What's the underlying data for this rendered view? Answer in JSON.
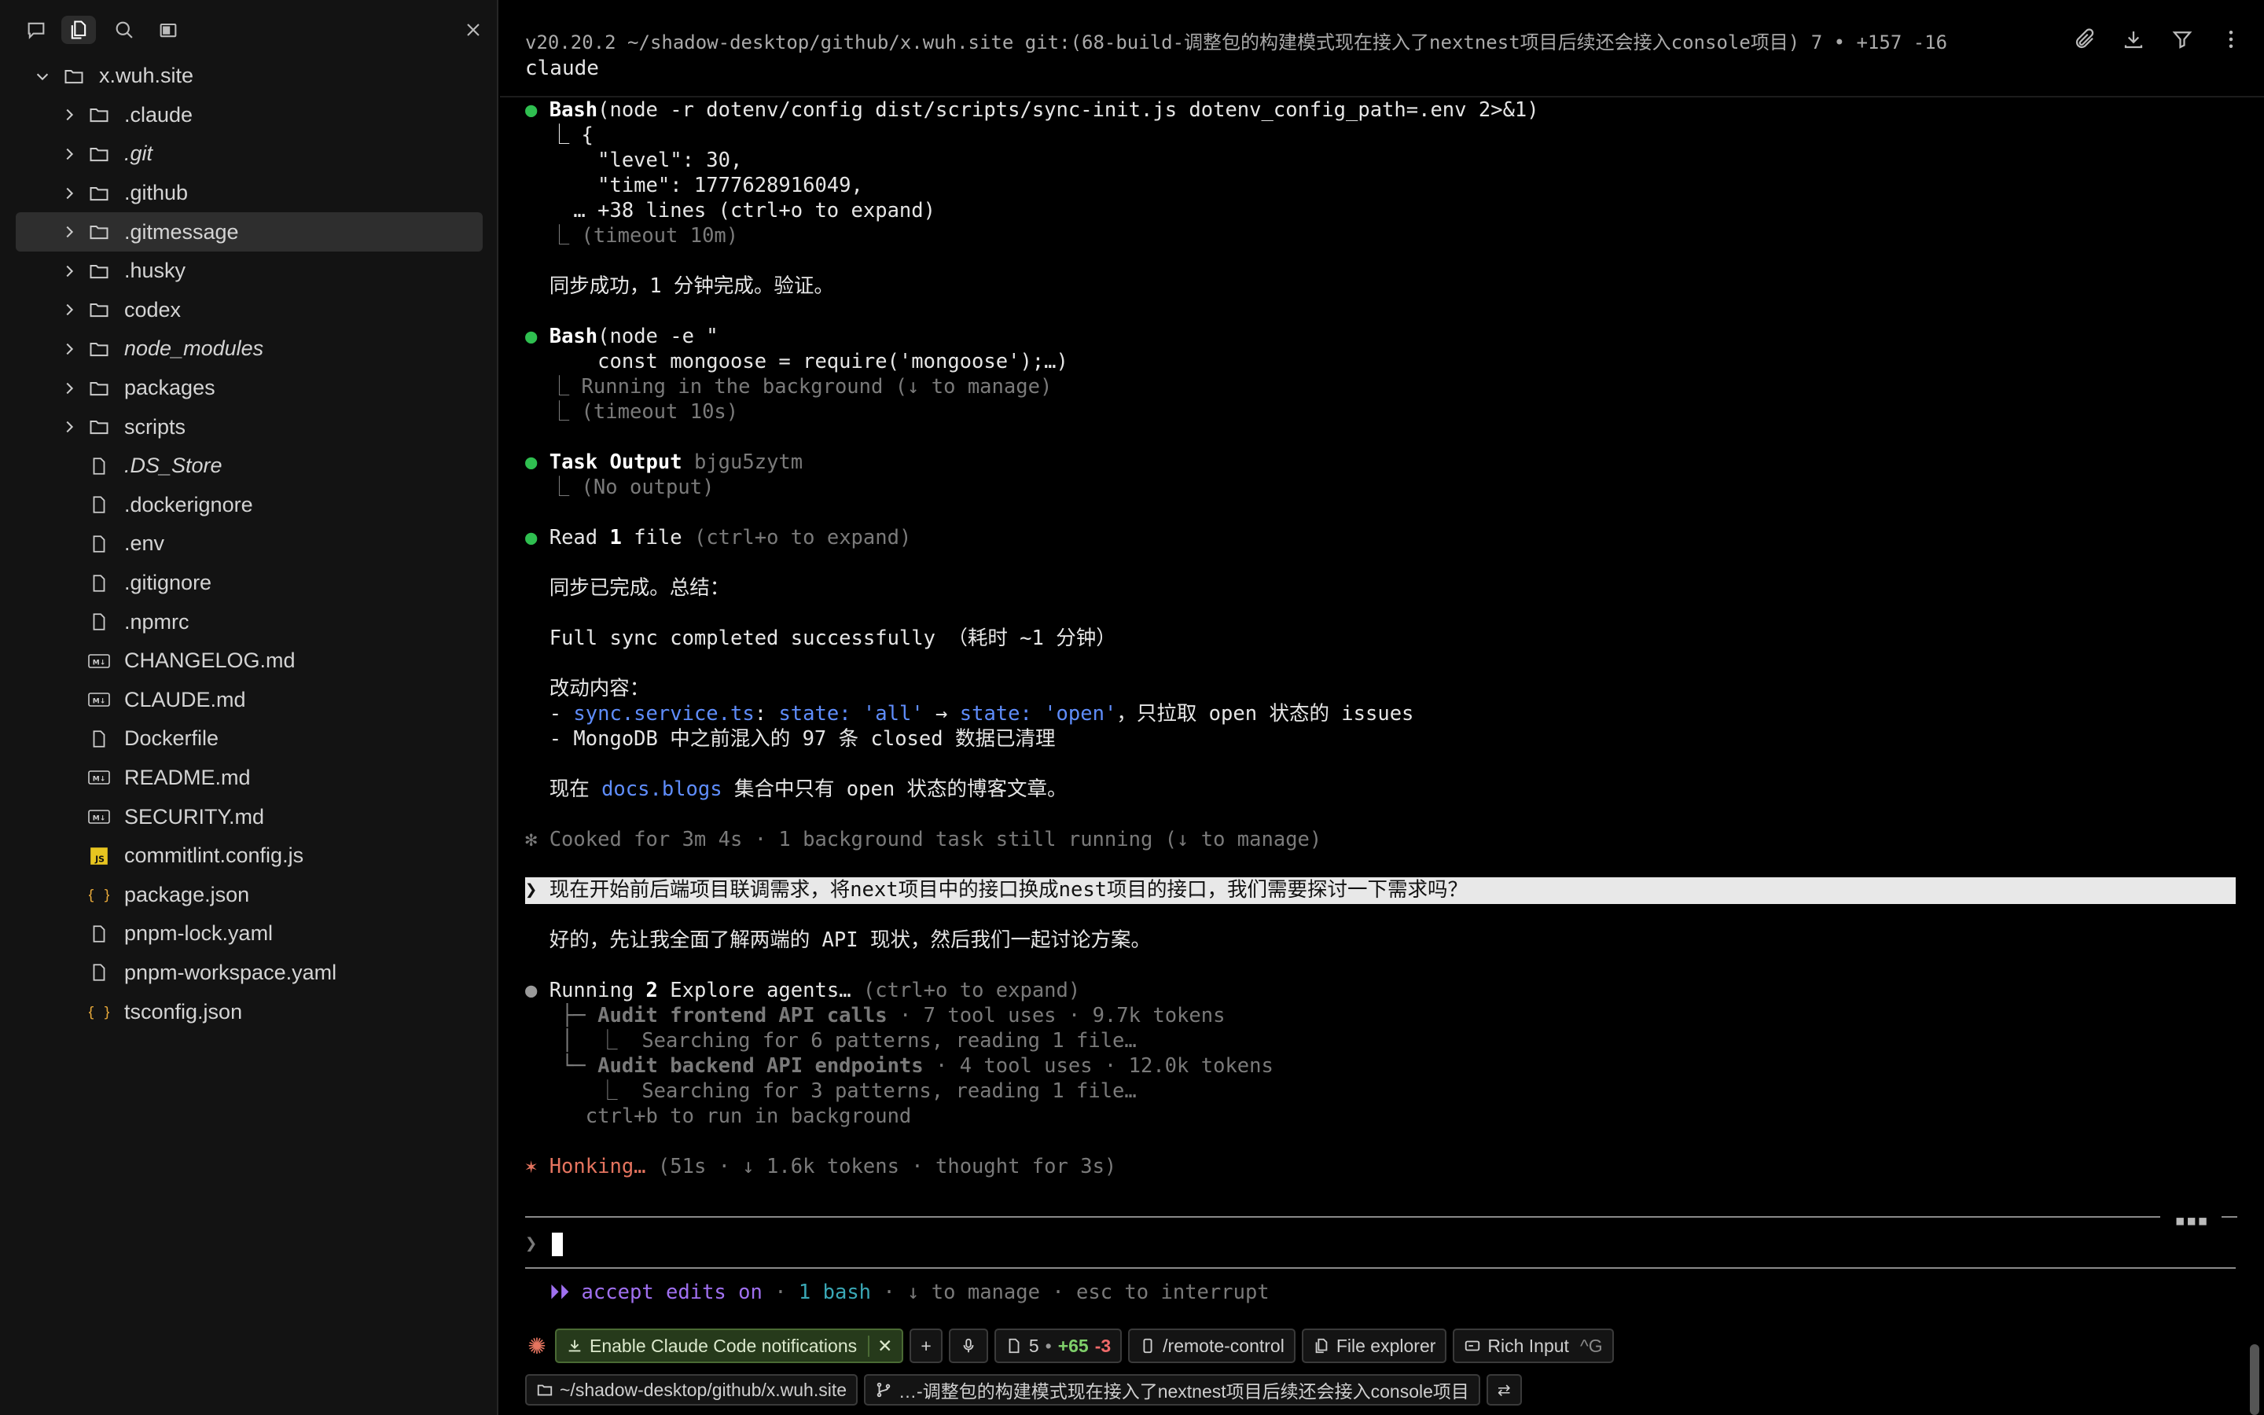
{
  "sidebar": {
    "root": "x.wuh.site",
    "items": [
      {
        "name": ".claude",
        "type": "folder",
        "italic": false
      },
      {
        "name": ".git",
        "type": "folder",
        "italic": true
      },
      {
        "name": ".github",
        "type": "folder",
        "italic": false
      },
      {
        "name": ".gitmessage",
        "type": "folder",
        "italic": false,
        "selected": true
      },
      {
        "name": ".husky",
        "type": "folder",
        "italic": false
      },
      {
        "name": "codex",
        "type": "folder",
        "italic": false
      },
      {
        "name": "node_modules",
        "type": "folder",
        "italic": true
      },
      {
        "name": "packages",
        "type": "folder",
        "italic": false
      },
      {
        "name": "scripts",
        "type": "folder",
        "italic": false
      },
      {
        "name": ".DS_Store",
        "type": "file",
        "italic": true
      },
      {
        "name": ".dockerignore",
        "type": "file",
        "italic": false
      },
      {
        "name": ".env",
        "type": "file",
        "italic": false
      },
      {
        "name": ".gitignore",
        "type": "file",
        "italic": false
      },
      {
        "name": ".npmrc",
        "type": "file",
        "italic": false
      },
      {
        "name": "CHANGELOG.md",
        "type": "md",
        "italic": false
      },
      {
        "name": "CLAUDE.md",
        "type": "md",
        "italic": false
      },
      {
        "name": "Dockerfile",
        "type": "file",
        "italic": false
      },
      {
        "name": "README.md",
        "type": "md",
        "italic": false
      },
      {
        "name": "SECURITY.md",
        "type": "md",
        "italic": false
      },
      {
        "name": "commitlint.config.js",
        "type": "js",
        "italic": false
      },
      {
        "name": "package.json",
        "type": "json",
        "italic": false
      },
      {
        "name": "pnpm-lock.yaml",
        "type": "file",
        "italic": false
      },
      {
        "name": "pnpm-workspace.yaml",
        "type": "file",
        "italic": false
      },
      {
        "name": "tsconfig.json",
        "type": "json",
        "italic": false
      }
    ]
  },
  "terminal": {
    "header_path": "v20.20.2 ~/shadow-desktop/github/x.wuh.site git:(68-build-调整包的构建模式现在接入了nextnest项目后续还会接入console项目) 7 • +157 -16",
    "header_sub": "claude",
    "lines": {
      "l1_tool": "Bash",
      "l1_args": "(node -r dotenv/config dist/scripts/sync-init.js dotenv_config_path=.env 2>&1)",
      "l2": "  ⎿ {",
      "l3": "      \"level\": 30,",
      "l4": "      \"time\": 1777628916049,",
      "l5": "    … +38 lines (ctrl+o to expand)",
      "l6": "  ⎿ (timeout 10m)",
      "l7": "  同步成功，1 分钟完成。验证。",
      "l8_tool": "Bash",
      "l8_args": "(node -e \"",
      "l9": "      const mongoose = require('mongoose');…)",
      "l10": "  ⎿ Running in the background (↓ to manage)",
      "l11": "  ⎿ (timeout 10s)",
      "l12_tool": "Task Output",
      "l12_id": " bjgu5zytm",
      "l13": "  ⎿ (No output)",
      "l14_a": "Read ",
      "l14_b": "1",
      "l14_c": " file",
      "l14_d": " (ctrl+o to expand)",
      "l15": "  同步已完成。总结：",
      "l16": "  Full sync completed successfully （耗时 ~1 分钟）",
      "l17": "  改动内容：",
      "l18_a": "  - ",
      "l18_b": "sync.service.ts",
      "l18_c": ": ",
      "l18_d": "state: 'all'",
      "l18_e": " → ",
      "l18_f": "state: 'open'",
      "l18_g": "，只拉取 open 状态的 issues",
      "l19": "  - MongoDB 中之前混入的 97 条 closed 数据已清理",
      "l20_a": "  现在 ",
      "l20_b": "docs.blogs",
      "l20_c": " 集合中只有 open 状态的博客文章。",
      "l21": "✻ Cooked for 3m 4s · 1 background task still running (↓ to manage)",
      "l22": "❯ 现在开始前后端项目联调需求，将next项目中的接口换成nest项目的接口，我们需要探讨一下需求吗？",
      "l23": "  好的，先让我全面了解两端的 API 现状，然后我们一起讨论方案。",
      "l24_a": "Running ",
      "l24_b": "2",
      "l24_c": " Explore agents…",
      "l24_d": " (ctrl+o to expand)",
      "l25_a": "   ├─ ",
      "l25_b": "Audit frontend API calls",
      "l25_c": " · 7 tool uses · 9.7k tokens",
      "l26": "   │  ⎿  Searching for 6 patterns, reading 1 file…",
      "l27_a": "   └─ ",
      "l27_b": "Audit backend API endpoints",
      "l27_c": " · 4 tool uses · 12.0k tokens",
      "l28": "      ⎿  Searching for 3 patterns, reading 1 file…",
      "l29": "     ctrl+b to run in background",
      "l30_a": "✶ Honking…",
      "l30_b": " (51s · ↓ 1.6k tokens · thought for 3s)",
      "prompt_char": "❯",
      "l31_a": "  ⏵⏵ accept edits on",
      "l31_b": " · ",
      "l31_c": "1 bash",
      "l31_d": " · ↓ to manage · esc to interrupt"
    }
  },
  "statusbar": {
    "notif": "Enable Claude Code notifications",
    "changes_files": "5",
    "changes_add": "+65",
    "changes_del": "-3",
    "remote": "/remote-control",
    "file_explorer": "File explorer",
    "rich_input": "Rich Input",
    "rich_input_key": "^G",
    "path": "~/shadow-desktop/github/x.wuh.site",
    "branch": "…-调整包的构建模式现在接入了nextnest项目后续还会接入console项目"
  },
  "colors": {
    "accent_green": "#2fbf50",
    "link_blue": "#5f8dfb",
    "spinner_orange": "#e5745f",
    "mode_purple": "#a070f0"
  }
}
